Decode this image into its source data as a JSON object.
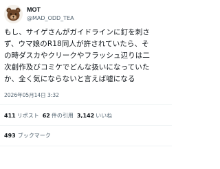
{
  "author": {
    "display_name": "MOT",
    "handle": "@MAD_ODD_TEA"
  },
  "tweet": {
    "lines": [
      "もし、サイゲさんがガイドラインに釘を刺さ",
      "ず、ウマ娘のR18同人が許されていたら、そ",
      "の時ダスカやクリークやフラッシュ辺りは二",
      "次創作及びコミケでどんな扱いになっていた",
      "か、全く気にならないと言えば嘘になる"
    ],
    "timestamp": "2026年05月14日 3:32"
  },
  "stats": {
    "reposts_count": "411",
    "reposts_label": "リポスト",
    "quotes_count": "62",
    "quotes_label": "件の引用",
    "likes_count": "3,142",
    "likes_label": "いいね",
    "bookmarks_count": "493",
    "bookmarks_label": "ブックマーク"
  },
  "colors": {
    "text_primary": "#0f1419",
    "text_secondary": "#536471",
    "divider": "#eff3f4"
  }
}
